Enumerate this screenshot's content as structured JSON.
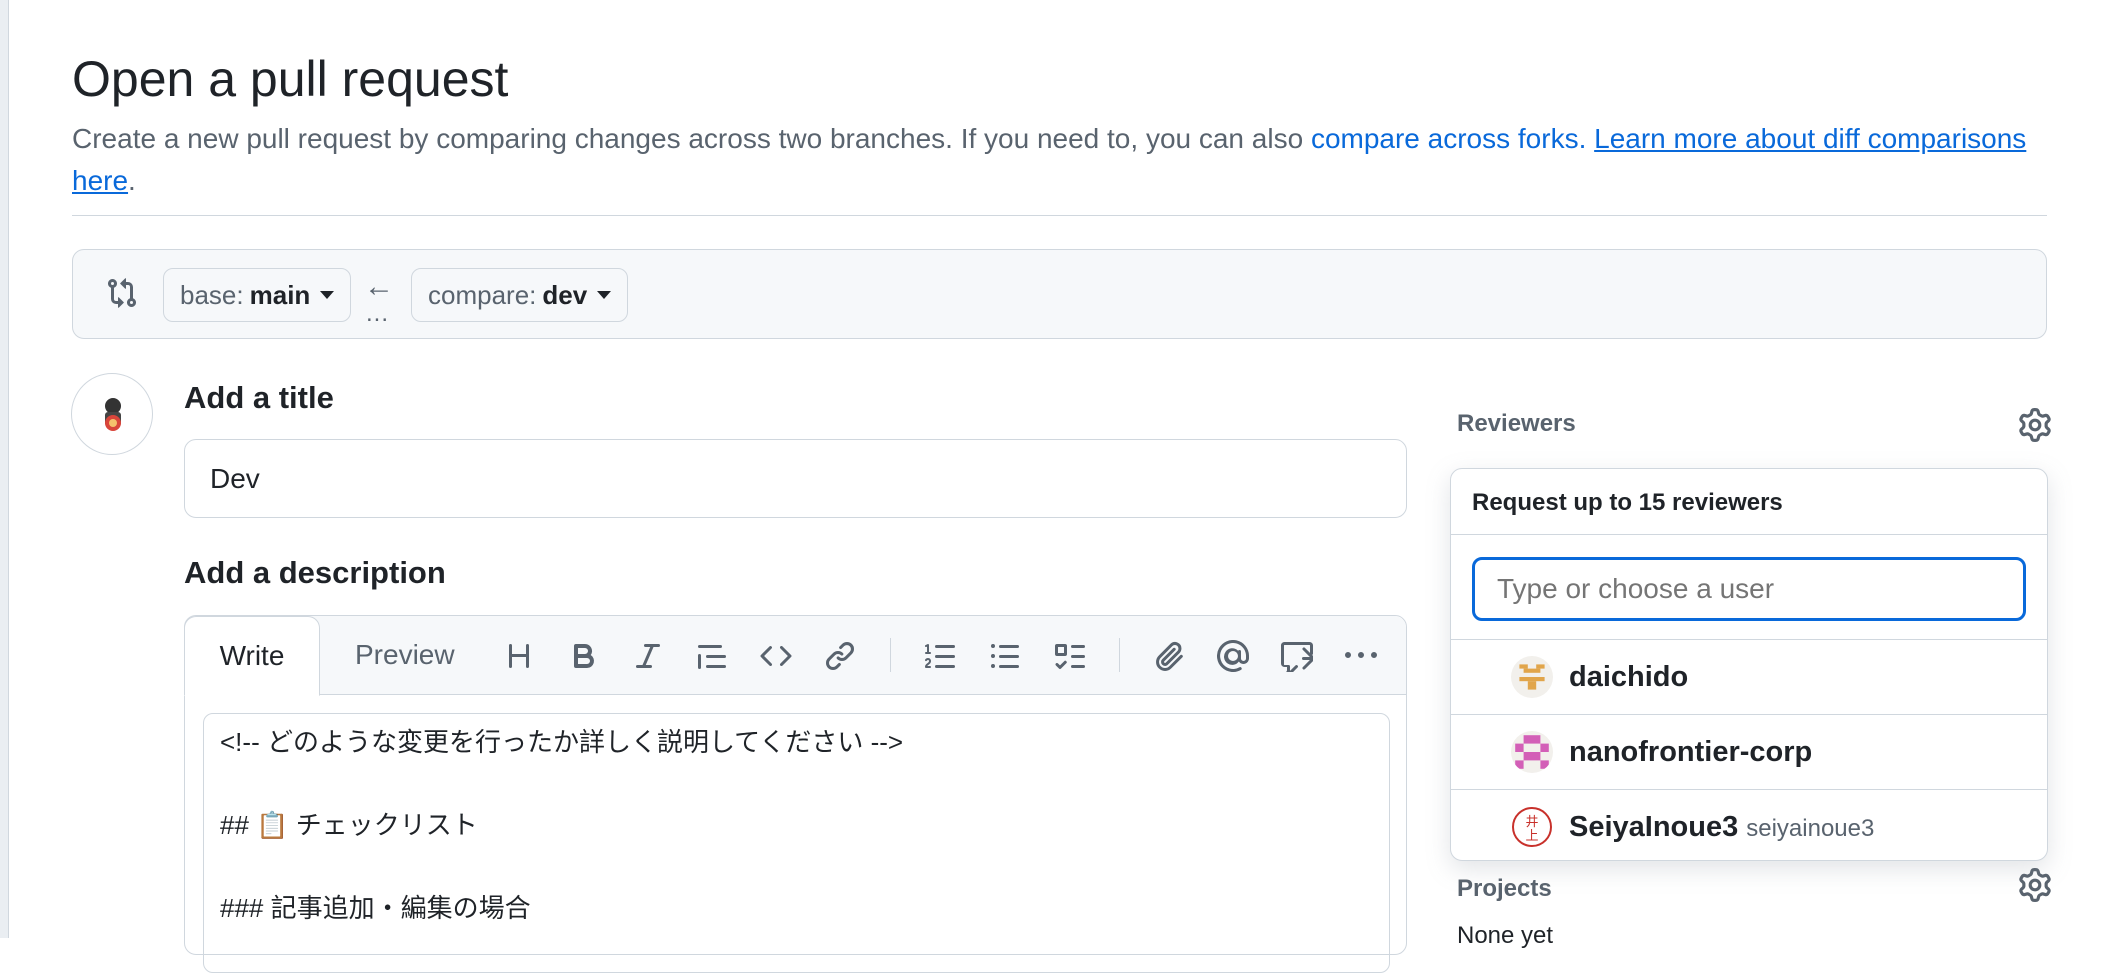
{
  "page": {
    "heading": "Open a pull request",
    "subtitle_prefix": "Create a new pull request by comparing changes across two branches. If you need to, you can also ",
    "compare_forks_link": "compare across forks.",
    "learn_more_link": "Learn more about diff comparisons here",
    "subtitle_suffix": "."
  },
  "range": {
    "base_label": "base:",
    "base_value": "main",
    "compare_label": "compare:",
    "compare_value": "dev",
    "arrow": "←",
    "dots": "..."
  },
  "form": {
    "title_label": "Add a title",
    "title_value": "Dev",
    "description_label": "Add a description",
    "tab_write": "Write",
    "tab_preview": "Preview",
    "toolbar_icons": [
      "heading-icon",
      "bold-icon",
      "italic-icon",
      "quote-icon",
      "code-icon",
      "link-icon",
      "numbered-list-icon",
      "bulleted-list-icon",
      "task-list-icon",
      "attach-icon",
      "mention-icon",
      "reference-icon",
      "more-icon"
    ],
    "body_lines": [
      "<!-- どのような変更を行ったか詳しく説明してください -->",
      "",
      "## 📋 チェックリスト",
      "",
      "### 記事追加・編集の場合"
    ]
  },
  "sidebar": {
    "reviewers_label": "Reviewers",
    "projects_label": "Projects",
    "projects_value": "None yet"
  },
  "reviewer_popover": {
    "title": "Request up to 15 reviewers",
    "search_placeholder": "Type or choose a user",
    "users": [
      {
        "name": "daichido",
        "login": "",
        "avatar_color": "#e1a54b"
      },
      {
        "name": "nanofrontier-corp",
        "login": "",
        "avatar_color": "#d35fb7"
      },
      {
        "name": "SeiyaInoue3",
        "login": "seiyainoue3",
        "avatar_color": "#c8312b"
      }
    ]
  }
}
